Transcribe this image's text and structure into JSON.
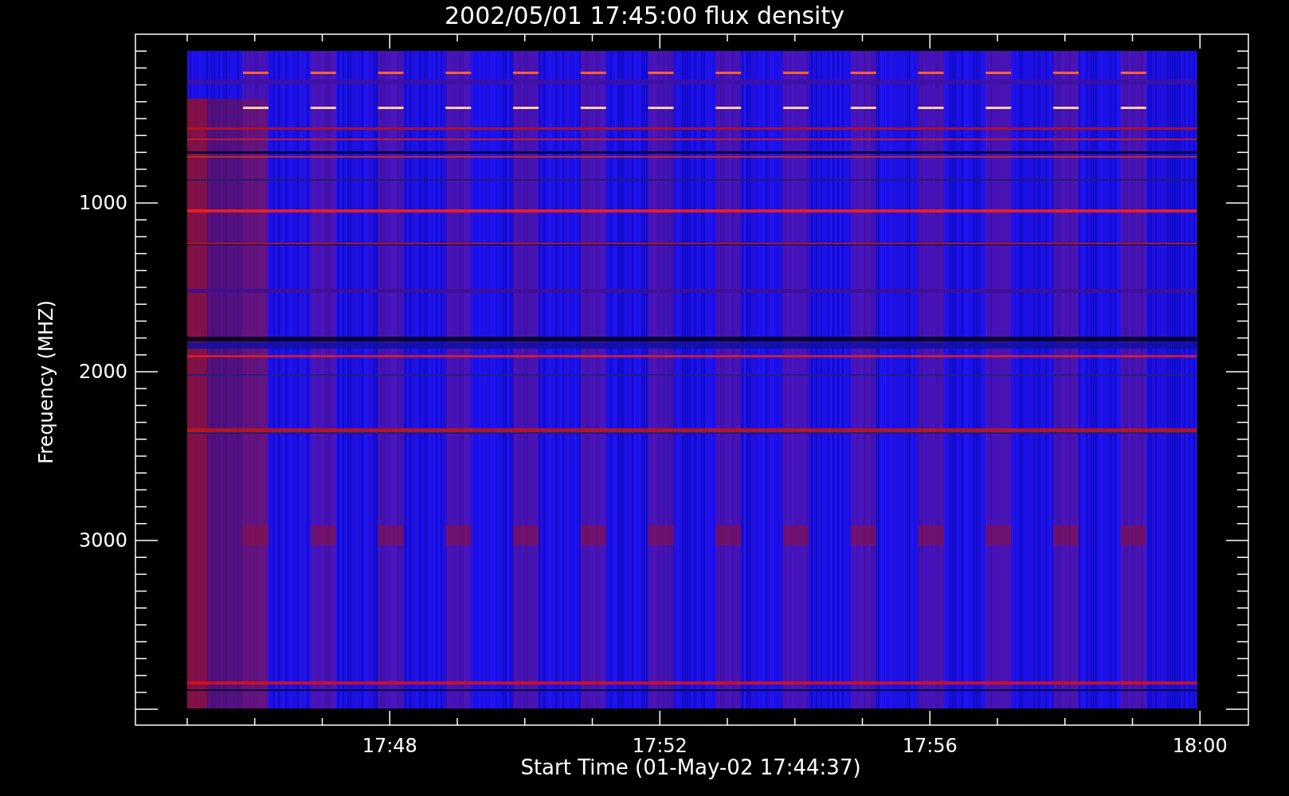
{
  "title": "2002/05/01 17:45:00 flux density",
  "x_axis": {
    "label": "Start Time (01-May-02 17:44:37)",
    "ticks": [
      "17:48",
      "17:52",
      "17:56",
      "18:00"
    ]
  },
  "y_axis": {
    "label": "Frequency (MHZ)",
    "ticks": [
      "1000",
      "2000",
      "3000"
    ]
  }
}
